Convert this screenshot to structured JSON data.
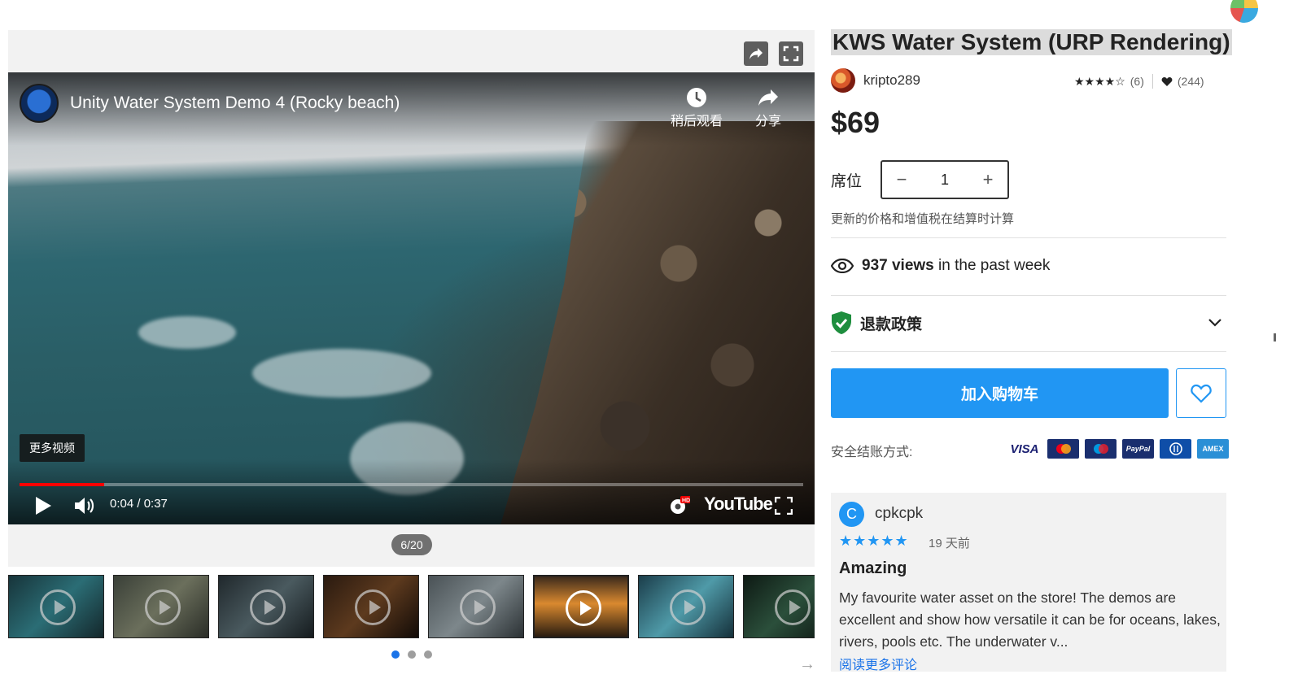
{
  "media": {
    "video_title": "Unity Water System Demo 4 (Rocky beach)",
    "watch_later_label": "稍后观看",
    "share_label": "分享",
    "more_videos_label": "更多视频",
    "time": "0:04 / 0:37",
    "progress": 0.108,
    "youtube_logo": "YouTube",
    "hd_badge": "HD",
    "counter": "6/20",
    "thumbnail_count": 8,
    "active_thumbnail": 6,
    "active_dot": 1,
    "dot_count": 3
  },
  "product": {
    "title": "KWS Water System (URP Rendering)",
    "publisher": "kripto289",
    "rating_count": "(6)",
    "favorites": "(244)",
    "rating": 4,
    "price": "$69",
    "seat_label": "席位",
    "quantity": "1",
    "vat_note": "更新的价格和增值税在结算时计算",
    "views_count": "937 views",
    "views_suffix": "in the past week",
    "refund_label": "退款政策",
    "add_to_cart": "加入购物车",
    "secure_checkout": "安全结账方式:",
    "payment_methods": [
      "VISA",
      "mastercard",
      "maestro",
      "PayPal",
      "Diners",
      "AMEX"
    ]
  },
  "review": {
    "avatar_letter": "C",
    "author": "cpkcpk",
    "stars": "★★★★★",
    "date": "19 天前",
    "title": "Amazing",
    "body": "My favourite water asset on the store! The demos are excellent and show how versatile it can be for oceans, lakes, rivers, pools etc. The underwater v...",
    "read_more": "阅读更多评论"
  },
  "colors": {
    "accent": "#2196f3",
    "progress_red": "#ff0000",
    "shield_green": "#1e8e3e"
  }
}
